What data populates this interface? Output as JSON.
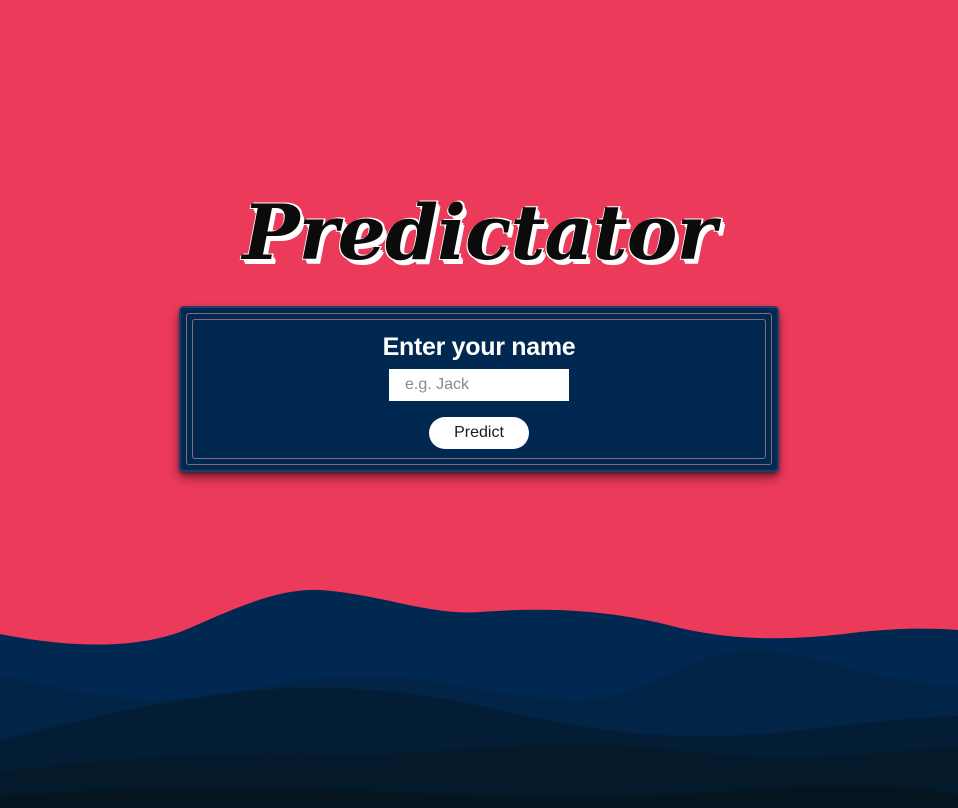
{
  "app": {
    "title": "Predictator"
  },
  "form": {
    "heading": "Enter your name",
    "name_placeholder": "e.g. Jack",
    "submit_label": "Predict"
  },
  "theme": {
    "background": "#ec3a5b",
    "card_background": "#012851",
    "wave_colors": [
      "#012851",
      "#022447",
      "#031d35",
      "#041a2a",
      "#05151f"
    ]
  }
}
